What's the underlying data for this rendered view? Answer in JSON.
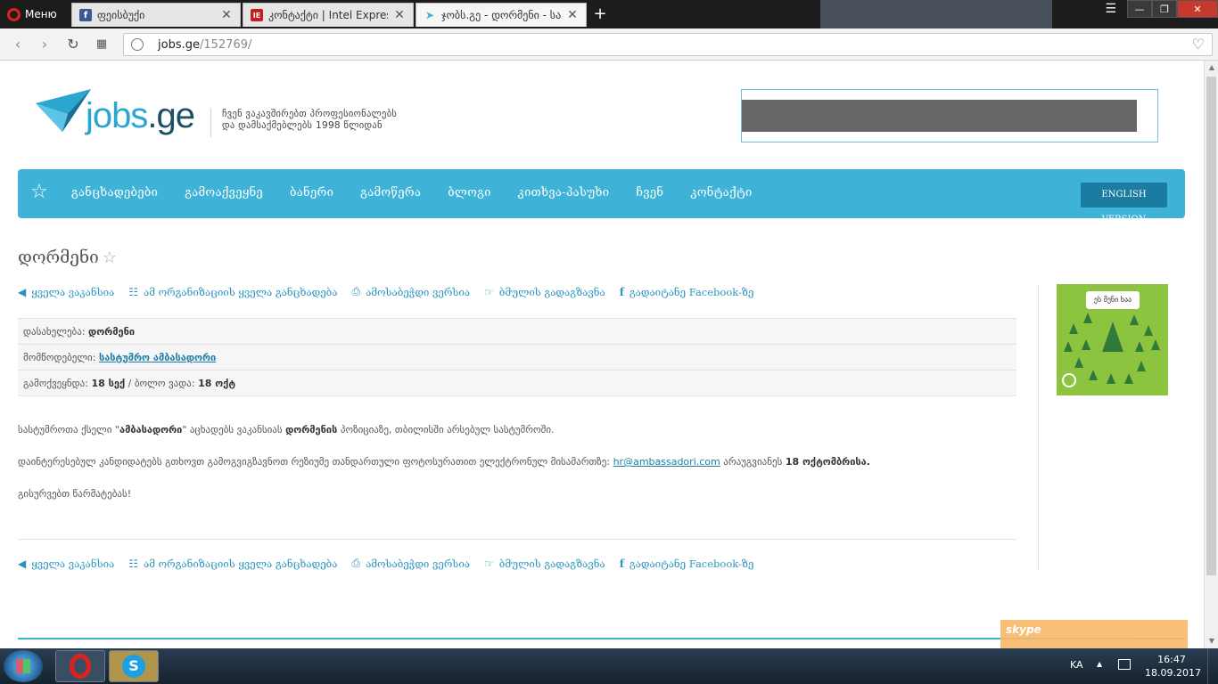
{
  "browser": {
    "menu_label": "Меню",
    "tabs": [
      {
        "title": "ფეისბუქი",
        "icon": "facebook-icon"
      },
      {
        "title": "კონტაქტი | Intel Express",
        "icon": "intel-express-icon"
      },
      {
        "title": "ჯობს.გე - დორმენი - სას",
        "icon": "jobs-plane-icon"
      }
    ],
    "url_host": "jobs.ge",
    "url_path": "/152769/"
  },
  "header": {
    "logo_main": "jobs",
    "logo_tld": ".ge",
    "tagline_line1": "ჩვენ ვაკავშირებთ პროფესიონალებს",
    "tagline_line2": "და დამსაქმებლებს 1998 წლიდან"
  },
  "nav": {
    "items": [
      "განცხადებები",
      "გამოაქვეყნე",
      "ბანერი",
      "გამოწერა",
      "ბლოგი",
      "კითხვა-პასუხი",
      "ჩვენ",
      "კონტაქტი"
    ],
    "english_version": "ENGLISH VERSION"
  },
  "page": {
    "title": "დორმენი",
    "actions": {
      "all_vacancies": "ყველა ვაკანსია",
      "org_announcements": "ამ ორგანიზაციის ყველა განცხადება",
      "print_version": "ამოსაბეჭდი ვერსია",
      "send_friend": "ბმულის გადაგზავნა",
      "share_facebook": "გადაიტანე Facebook-ზე"
    },
    "details": {
      "position_label": "დასახელება:",
      "position_value": "დორმენი",
      "provider_label": "მომწოდებელი:",
      "provider_value": "სასტუმრო ამბასადორი",
      "published_label": "გამოქვეყნდა:",
      "published_value": "18 სექ",
      "separator": "/",
      "deadline_label": "ბოლო ვადა:",
      "deadline_value": "18 ოქტ"
    },
    "body": {
      "p1_a": "სასტუმროთა ქსელი \"",
      "p1_b": "ამბასადორი",
      "p1_c": "\" აცხადებს ვაკანსიას ",
      "p1_d": "დორმენის",
      "p1_e": " პოზიციაზე, თბილისში არსებულ სასტუმროში.",
      "p2_a": "დაინტერესებულ კანდიდატებს გთხოვთ გამოგვიგზავნოთ რეზიუმე თანდართული ფოტოსურათით ელექტრონულ მისამართზე: ",
      "p2_email": "hr@ambassadori.com",
      "p2_b": " არაუგვიანეს ",
      "p2_c": "18 ოქტომბრისა.",
      "p3": "გისურვებთ წარმატებას!"
    }
  },
  "side_ad": {
    "bubble_text": "ეს შენი ხაა"
  },
  "skype_label": "skype",
  "taskbar": {
    "lang": "KA",
    "time": "16:47",
    "date": "18.09.2017"
  },
  "colors": {
    "accent": "#3fb3d7",
    "link": "#2a94bf",
    "dark_button": "#1b7ba1",
    "ad_green": "#8dc43f"
  }
}
